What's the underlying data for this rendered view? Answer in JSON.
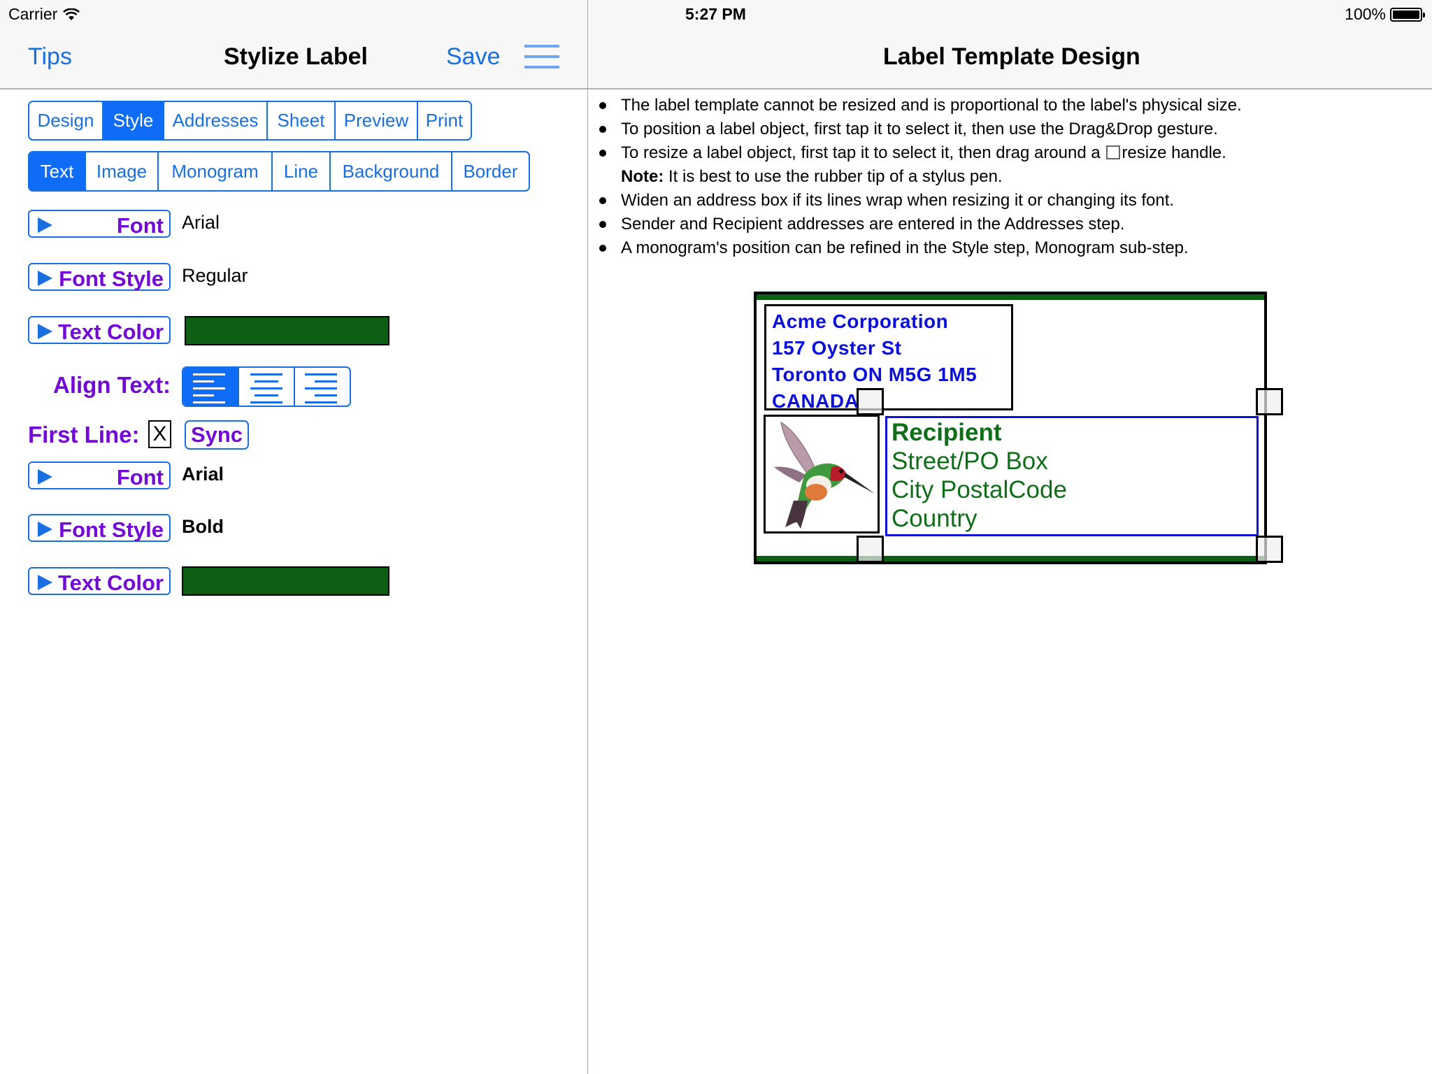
{
  "status_bar": {
    "carrier": "Carrier",
    "time": "5:27 PM",
    "battery": "100%",
    "battery_level": 1.0
  },
  "left_nav": {
    "tips_label": "Tips",
    "title": "Stylize Label",
    "save_label": "Save",
    "menu_icon": "hamburger-menu-icon"
  },
  "right_nav": {
    "title": "Label Template Design"
  },
  "step_tabs": {
    "items": [
      "Design",
      "Style",
      "Addresses",
      "Sheet",
      "Preview",
      "Print"
    ],
    "selected": "Style"
  },
  "substep_tabs": {
    "items": [
      "Text",
      "Image",
      "Monogram",
      "Line",
      "Background",
      "Border"
    ],
    "selected": "Text"
  },
  "text_settings": {
    "font_label": "Font",
    "font_value": "Arial",
    "font_style_label": "Font Style",
    "font_style_value": "Regular",
    "text_color_label": "Text Color",
    "text_color_value": "#0f5e16",
    "align_label": "Align Text:",
    "align_options": [
      "left",
      "center",
      "right"
    ],
    "align_selected": "left"
  },
  "first_line": {
    "label": "First Line:",
    "checkbox_mark": "X",
    "checked": true,
    "sync_label": "Sync",
    "font_label": "Font",
    "font_value": "Arial",
    "font_style_label": "Font Style",
    "font_style_value": "Bold",
    "text_color_label": "Text Color",
    "text_color_value": "#0f5e16"
  },
  "tips": {
    "items": [
      "The label template cannot be resized and is proportional to the label's physical size.",
      "To position a label object, first tap it to select it, then use the Drag&Drop gesture.",
      "Widen an address box if its lines wrap when resizing it or changing its font.",
      "Sender and Recipient addresses are entered in the Addresses step.",
      "A monogram's position can be refined in the Style step, Monogram sub-step."
    ],
    "resize_prefix": "To resize a label object, first tap it to select it, then drag around a",
    "resize_suffix": "resize handle.",
    "note_bold": "Note:",
    "note_text": " It is best to use the rubber tip of a stylus pen."
  },
  "label": {
    "border_color": "#0f5e16",
    "sender_color": "#0a10d8",
    "recipient_color": "#0f6e18",
    "sender_lines": [
      "Acme Corporation",
      "157 Oyster St",
      "Toronto ON M5G 1M5",
      "CANADA"
    ],
    "recipient_lines": [
      "Recipient",
      "Street/PO Box",
      "City PostalCode",
      "Country"
    ],
    "image": "hummingbird-image"
  }
}
